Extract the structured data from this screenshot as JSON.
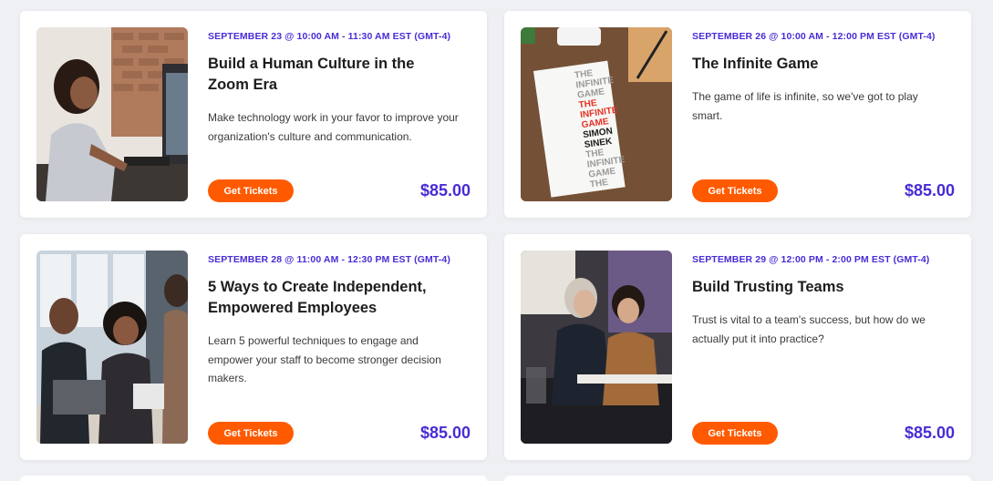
{
  "events": [
    {
      "date": "SEPTEMBER 23 @ 10:00 AM - 11:30 AM EST (GMT-4)",
      "title": "Build a Human Culture in the Zoom Era",
      "description": "Make technology work in your favor to improve your organization's culture and communication.",
      "button": "Get Tickets",
      "price": "$85.00",
      "image_icon": "woman-video-call-photo"
    },
    {
      "date": "SEPTEMBER 26 @ 10:00 AM - 12:00 PM EST (GMT-4)",
      "title": "The Infinite Game",
      "description": "The game of life is infinite, so we've got to play smart.",
      "button": "Get Tickets",
      "price": "$85.00",
      "image_icon": "book-cover-photo",
      "book": {
        "lines": [
          "THE",
          "INFINITE",
          "GAME",
          "THE",
          "INFINITE",
          "GAME",
          "SIMON",
          "SINEK",
          "THE",
          "INFINITE",
          "GAME",
          "THE"
        ]
      }
    },
    {
      "date": "SEPTEMBER 28 @ 11:00 AM - 12:30 PM EST (GMT-4)",
      "title": "5 Ways to Create Independent, Empowered Employees",
      "description": "Learn 5 powerful techniques to engage and empower your staff to become stronger decision makers.",
      "button": "Get Tickets",
      "price": "$85.00",
      "image_icon": "team-laughing-photo"
    },
    {
      "date": "SEPTEMBER 29 @ 12:00 PM - 2:00 PM EST (GMT-4)",
      "title": "Build Trusting Teams",
      "description": "Trust is vital to a team's success, but how do we actually put it into practice?",
      "button": "Get Tickets",
      "price": "$85.00",
      "image_icon": "colleagues-desk-photo"
    }
  ],
  "colors": {
    "accent": "#4a2bd6",
    "button": "#ff5a00",
    "background": "#eef0f4"
  }
}
